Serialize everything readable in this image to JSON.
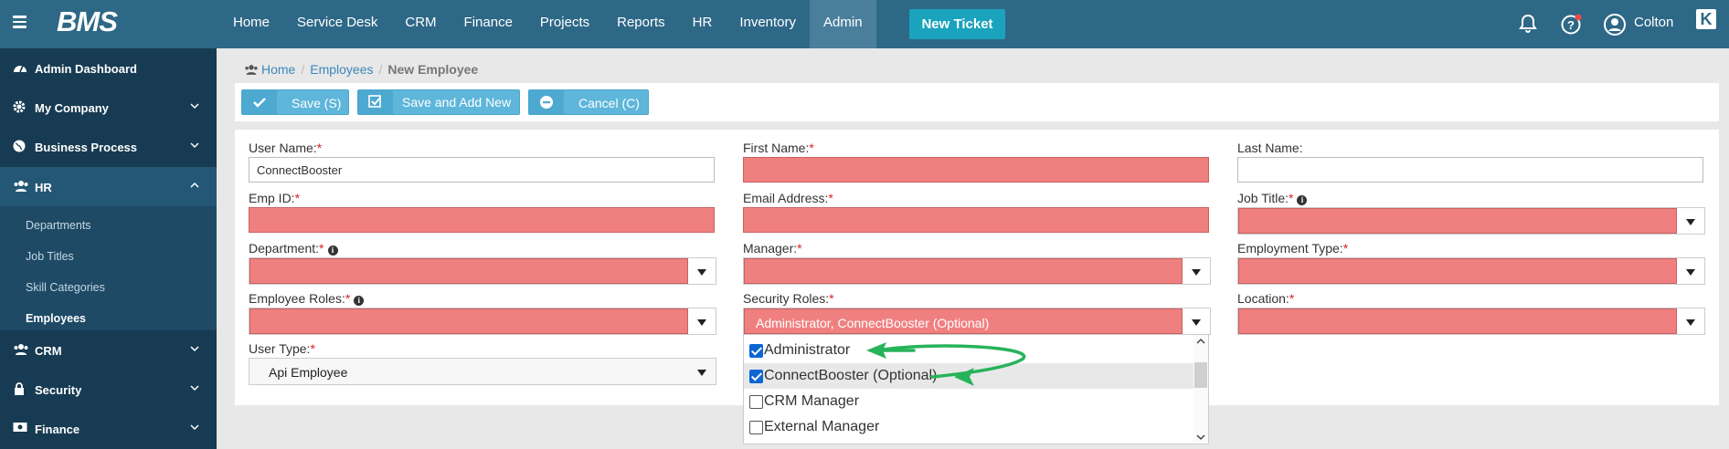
{
  "app": {
    "logo": "BMS",
    "user": "Colton",
    "corner_logo": "K"
  },
  "nav": {
    "items": [
      "Home",
      "Service Desk",
      "CRM",
      "Finance",
      "Projects",
      "Reports",
      "HR",
      "Inventory",
      "Admin"
    ],
    "active": "Admin",
    "new_ticket": "New Ticket"
  },
  "sidebar": {
    "items": [
      {
        "label": "Admin Dashboard",
        "icon": "dashboard-icon"
      },
      {
        "label": "My Company",
        "icon": "gear-icon"
      },
      {
        "label": "Business Process",
        "icon": "globe-icon"
      },
      {
        "label": "HR",
        "icon": "users-icon"
      },
      {
        "label": "CRM",
        "icon": "users-icon"
      },
      {
        "label": "Security",
        "icon": "lock-icon"
      },
      {
        "label": "Finance",
        "icon": "money-icon"
      }
    ],
    "hr_sub": [
      "Departments",
      "Job Titles",
      "Skill Categories",
      "Employees"
    ],
    "hr_sub_active": "Employees"
  },
  "breadcrumb": {
    "home": "Home",
    "section": "Employees",
    "current": "New Employee"
  },
  "toolbar": {
    "save": "Save (S)",
    "save_add": "Save and Add New",
    "cancel": "Cancel (C)"
  },
  "form": {
    "user_name": {
      "label": "User Name:",
      "value": "ConnectBooster"
    },
    "first_name": {
      "label": "First Name:"
    },
    "last_name": {
      "label": "Last Name:"
    },
    "emp_id": {
      "label": "Emp ID:"
    },
    "email": {
      "label": "Email Address:"
    },
    "job_title": {
      "label": "Job Title:"
    },
    "department": {
      "label": "Department:"
    },
    "manager": {
      "label": "Manager:"
    },
    "employment_type": {
      "label": "Employment Type:"
    },
    "employee_roles": {
      "label": "Employee Roles:"
    },
    "security_roles": {
      "label": "Security Roles:",
      "value": "Administrator, ConnectBooster (Optional)"
    },
    "location": {
      "label": "Location:"
    },
    "user_type": {
      "label": "User Type:",
      "value": "Api Employee"
    },
    "required_mark": "*"
  },
  "security_roles_options": [
    {
      "label": "Administrator",
      "checked": true
    },
    {
      "label": "ConnectBooster (Optional)",
      "checked": true
    },
    {
      "label": "CRM Manager",
      "checked": false
    },
    {
      "label": "External Manager",
      "checked": false
    }
  ],
  "colors": {
    "topbar": "#2e6887",
    "sidebar": "#173b52",
    "error_field": "#f08080",
    "accent": "#1aa3bd",
    "annotation_arrow": "#27b35a"
  }
}
